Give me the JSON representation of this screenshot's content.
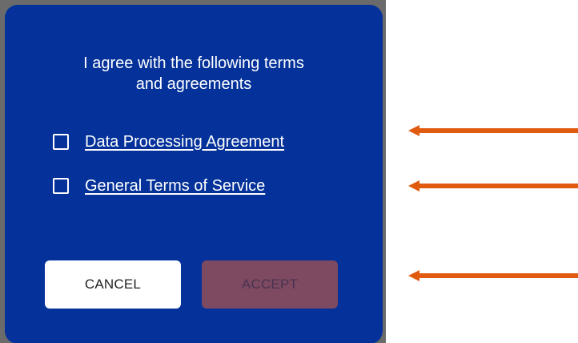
{
  "dialog": {
    "title_line1": "I agree with the following terms",
    "title_line2": "and agreements",
    "checkboxes": [
      {
        "label": "Data Processing Agreement",
        "checked": false
      },
      {
        "label": "General Terms of Service",
        "checked": false
      }
    ],
    "buttons": {
      "cancel": "CANCEL",
      "accept": "ACCEPT"
    }
  },
  "annotations": {
    "arrows": [
      "arrow-icon",
      "arrow-icon",
      "arrow-icon"
    ],
    "arrow_color": "#e05a10"
  },
  "colors": {
    "dialog_bg": "#04329a",
    "accept_disabled_bg": "#7d4a61",
    "cancel_bg": "#ffffff"
  }
}
